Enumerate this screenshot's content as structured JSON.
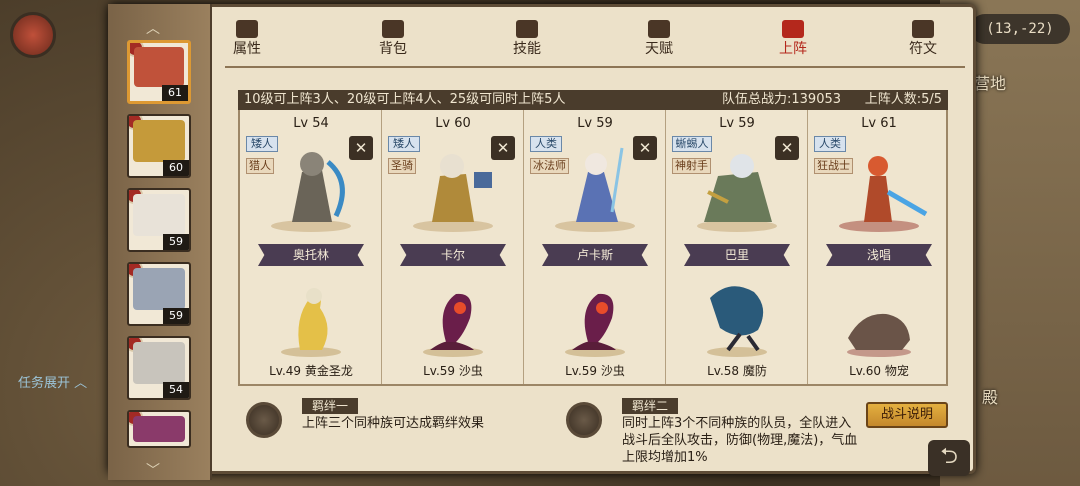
{
  "map": {
    "coords": "(13,-22)",
    "label_camp": "营地",
    "label_hall": "殿",
    "task_toggle": "任务展开"
  },
  "sidebar": {
    "portraits": [
      {
        "level": "61",
        "color": "#c0523a"
      },
      {
        "level": "60",
        "color": "#c59a3a"
      },
      {
        "level": "59",
        "color": "#e8e2d8"
      },
      {
        "level": "59",
        "color": "#9aa4b4"
      },
      {
        "level": "54",
        "color": "#c8c4bc"
      },
      {
        "level": "",
        "color": "#8a3a6a"
      }
    ]
  },
  "tabs": [
    {
      "label": "属性",
      "icon": "flame-icon"
    },
    {
      "label": "背包",
      "icon": "bag-icon"
    },
    {
      "label": "技能",
      "icon": "book-icon"
    },
    {
      "label": "天赋",
      "icon": "eye-icon"
    },
    {
      "label": "上阵",
      "icon": "crossed-swords-icon"
    },
    {
      "label": "符文",
      "icon": "rune-icon"
    }
  ],
  "team": {
    "rule": "10级可上阵3人、20级可上阵4人、25级可同时上阵5人",
    "power": "队伍总战力:139053",
    "count": "上阵人数:5/5"
  },
  "heroes": [
    {
      "level": "Lv 54",
      "race": "矮人",
      "cls": "猎人",
      "name": "奥托林",
      "pet": "Lv.49 黄金圣龙",
      "color": "#6a6458"
    },
    {
      "level": "Lv 60",
      "race": "矮人",
      "cls": "圣骑",
      "name": "卡尔",
      "pet": "Lv.59 沙虫",
      "color": "#b08a3a"
    },
    {
      "level": "Lv 59",
      "race": "人类",
      "cls": "冰法师",
      "name": "卢卡斯",
      "pet": "Lv.59 沙虫",
      "color": "#5a72b4"
    },
    {
      "level": "Lv 59",
      "race": "蜥蜴人",
      "cls": "神射手",
      "name": "巴里",
      "pet": "Lv.58 魔防",
      "color": "#6a7a5a"
    },
    {
      "level": "Lv 61",
      "race": "人类",
      "cls": "狂战士",
      "name": "浅唱",
      "pet": "Lv.60 物宠",
      "color": "#b04a2a"
    }
  ],
  "bonds": {
    "one_title": "羁绊一",
    "one_text": "上阵三个同种族可达成羁绊效果",
    "two_title": "羁绊二",
    "two_text_1": "同时上阵3个不同种族的队员，全队进入",
    "two_text_2": "战斗后全队攻击，防御(物理,魔法)，气血",
    "two_text_3": "上限均增加1%"
  },
  "buttons": {
    "explain": "战斗说明",
    "remove": "✕",
    "back": "⮌"
  }
}
